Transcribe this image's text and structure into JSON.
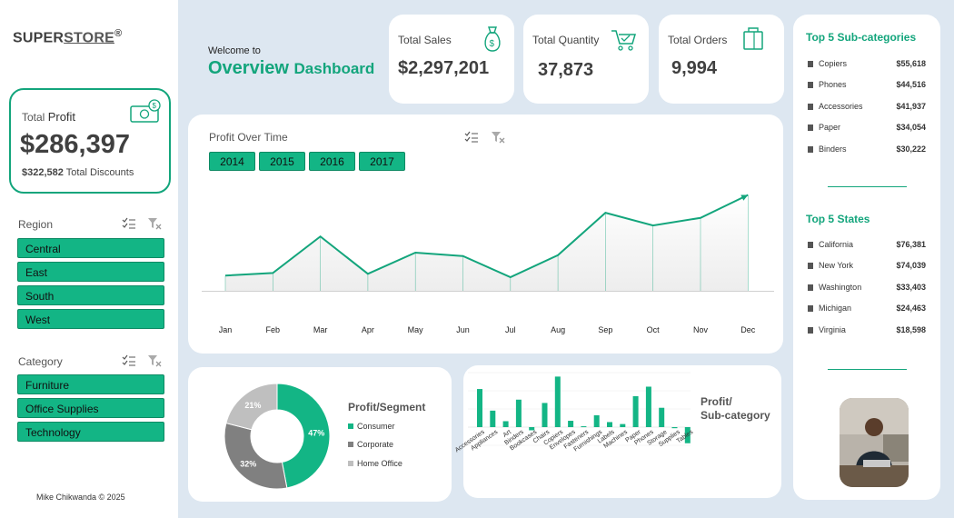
{
  "brand": {
    "super": "SUPER",
    "store": "STORE",
    "mark": "®"
  },
  "profit": {
    "label_total": "Total",
    "label_profit": "Profit",
    "value": "$286,397",
    "discount_value": "$322,582",
    "discount_label": "Total Discounts"
  },
  "region": {
    "title": "Region",
    "items": [
      "Central",
      "East",
      "South",
      "West"
    ]
  },
  "category": {
    "title": "Category",
    "items": [
      "Furniture",
      "Office Supplies",
      "Technology"
    ]
  },
  "footer": "Mike Chikwanda © 2025",
  "header": {
    "welcome": "Welcome to",
    "title_main": "Overview",
    "title_sub": "Dashboard"
  },
  "kpis": [
    {
      "label": "Total Sales",
      "value": "$2,297,201"
    },
    {
      "label": "Total Quantity",
      "value": "37,873"
    },
    {
      "label": "Total Orders",
      "value": "9,994"
    }
  ],
  "profit_chart": {
    "title": "Profit Over Time",
    "years": [
      "2014",
      "2015",
      "2016",
      "2017"
    ]
  },
  "top_subcategories": {
    "title": "Top 5 Sub-categories",
    "items": [
      {
        "name": "Copiers",
        "value": "$55,618"
      },
      {
        "name": "Phones",
        "value": "$44,516"
      },
      {
        "name": "Accessories",
        "value": "$41,937"
      },
      {
        "name": "Paper",
        "value": "$34,054"
      },
      {
        "name": "Binders",
        "value": "$30,222"
      }
    ]
  },
  "top_states": {
    "title": "Top 5 States",
    "items": [
      {
        "name": "California",
        "value": "$76,381"
      },
      {
        "name": "New York",
        "value": "$74,039"
      },
      {
        "name": "Washington",
        "value": "$33,403"
      },
      {
        "name": "Michigan",
        "value": "$24,463"
      },
      {
        "name": "Virginia",
        "value": "$18,598"
      }
    ]
  },
  "segment": {
    "title": "Profit/Segment",
    "legend": [
      "Consumer",
      "Corporate",
      "Home Office"
    ]
  },
  "subcat_chart": {
    "title_line1": "Profit/",
    "title_line2": "Sub-category"
  },
  "colors": {
    "accent": "#13a57c",
    "button": "#13b585",
    "consumer": "#13b585",
    "corporate": "#808080",
    "home_office": "#bfbfbf"
  },
  "chart_data": [
    {
      "type": "line",
      "title": "Profit Over Time",
      "categories": [
        "Jan",
        "Feb",
        "Mar",
        "Apr",
        "May",
        "Jun",
        "Jul",
        "Aug",
        "Sep",
        "Oct",
        "Nov",
        "Dec"
      ],
      "values": [
        9000,
        10500,
        32000,
        10000,
        22500,
        20500,
        8000,
        21000,
        46000,
        38500,
        43000,
        56500
      ],
      "ylim": [
        0,
        60000
      ],
      "grid": false
    },
    {
      "type": "pie",
      "title": "Profit/Segment",
      "categories": [
        "Consumer",
        "Corporate",
        "Home Office"
      ],
      "values": [
        47,
        32,
        21
      ]
    },
    {
      "type": "bar",
      "title": "Profit/ Sub-category",
      "categories": [
        "Accessories",
        "Appliances",
        "Art",
        "Binders",
        "Bookcases",
        "Chairs",
        "Copiers",
        "Envelopes",
        "Fasteners",
        "Furnishings",
        "Labels",
        "Machines",
        "Paper",
        "Phones",
        "Storage",
        "Supplies",
        "Tables"
      ],
      "values": [
        41937,
        18138,
        6528,
        30222,
        -3473,
        26590,
        55618,
        6964,
        950,
        13059,
        5546,
        3385,
        34054,
        44516,
        21279,
        -1189,
        -17725
      ],
      "ylim": [
        -20000,
        60000
      ]
    }
  ]
}
